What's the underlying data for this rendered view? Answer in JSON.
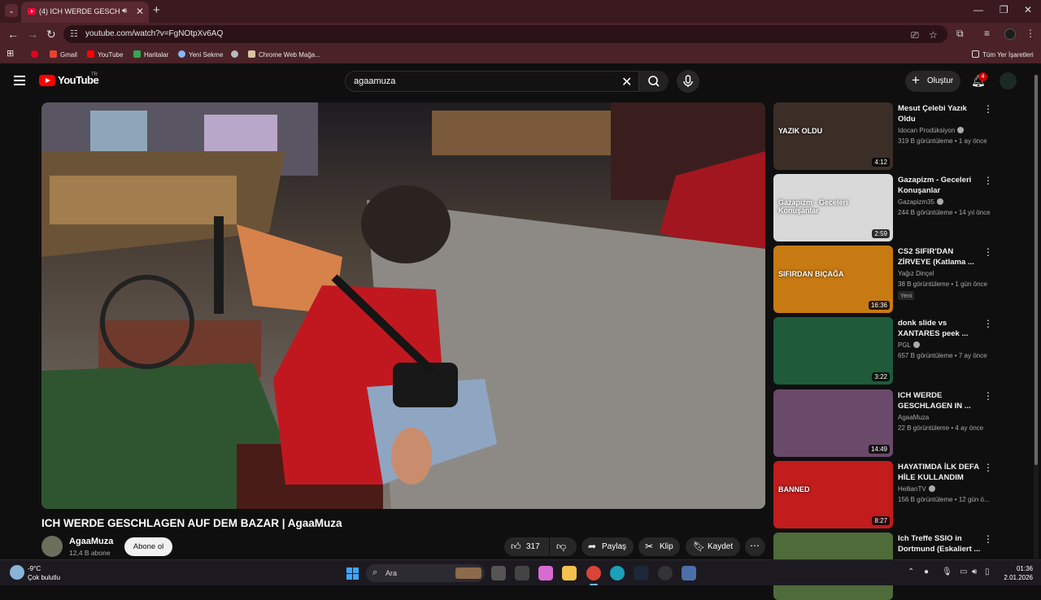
{
  "browser": {
    "tab_title": "(4) ICH WERDE GESCHLAGEN",
    "url": "youtube.com/watch?v=FgNOtpXv6AQ",
    "bookmarks": [
      "Gmail",
      "YouTube",
      "Haritalar",
      "Yeni Sekme",
      "Chrome Web Mağa...",
      "Tüm Yer İşaretleri"
    ]
  },
  "youtube": {
    "logo_text": "YouTube",
    "country": "TR",
    "search_query": "agaamuza",
    "create_label": "Oluştur",
    "notification_count": "4"
  },
  "video": {
    "title": "ICH WERDE GESCHLAGEN AUF DEM BAZAR | AgaaMuza",
    "channel": "AgaaMuza",
    "subscribers": "12,4 B abone",
    "subscribe_label": "Abone ol",
    "likes": "317",
    "share_label": "Paylaş",
    "clip_label": "Klip",
    "save_label": "Kaydet"
  },
  "recommendations": [
    {
      "title": "Mesut Çelebi Yazık Oldu",
      "channel": "Idocan Prodüksiyon",
      "verified": true,
      "meta": "319 B görüntüleme • 1 ay önce",
      "duration": "4:12",
      "badge": "",
      "thumb_text": "YAZIK OLDU",
      "thumb_color": "#3b2e26"
    },
    {
      "title": "Gazapizm - Geceleri Konuşanlar",
      "channel": "Gazapizm35",
      "verified": true,
      "meta": "244 B görüntüleme • 14 yıl önce",
      "duration": "2:59",
      "badge": "",
      "thumb_text": "Gazapizm - Geceleri Konuşanlar",
      "thumb_color": "#d9d9d9"
    },
    {
      "title": "CS2 SIFIR'DAN ZİRVEYE (Katlama ...",
      "channel": "Yağız Dinçel",
      "verified": false,
      "meta": "38 B görüntüleme • 1 gün önce",
      "duration": "16:36",
      "badge": "Yeni",
      "thumb_text": "SIFIRDAN BIÇAĞA",
      "thumb_color": "#c87a12"
    },
    {
      "title": "donk slide vs XANTARES peek ...",
      "channel": "PGL",
      "verified": true,
      "meta": "657 B görüntüleme • 7 ay önce",
      "duration": "3:22",
      "badge": "",
      "thumb_text": "",
      "thumb_color": "#1f5a3a"
    },
    {
      "title": "ICH WERDE GESCHLAGEN IN ...",
      "channel": "AgaaMuza",
      "verified": false,
      "meta": "22 B görüntüleme • 4 ay önce",
      "duration": "14:49",
      "badge": "",
      "thumb_text": "",
      "thumb_color": "#6a4a6a"
    },
    {
      "title": "HAYATIMDA İLK DEFA HİLE KULLANDIM",
      "channel": "HellianTV",
      "verified": true,
      "meta": "156 B görüntüleme • 12 gün ö...",
      "duration": "8:27",
      "badge": "",
      "thumb_text": "BANNED",
      "thumb_color": "#c21c1c"
    },
    {
      "title": "Ich Treffe SSIO in Dortmund (Eskaliert ...",
      "channel": "",
      "verified": false,
      "meta": "",
      "duration": "",
      "badge": "",
      "thumb_text": "",
      "thumb_color": "#4f6b3a"
    }
  ],
  "taskbar": {
    "temperature": "-9°C",
    "weather": "Çok bulutlu",
    "search_placeholder": "Ara",
    "time": "01:36",
    "date": "2.01.2026"
  }
}
